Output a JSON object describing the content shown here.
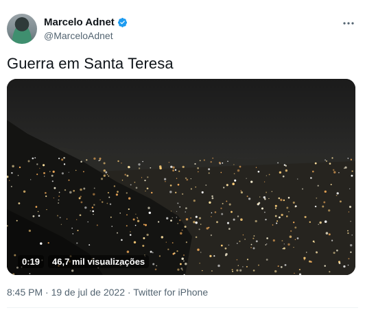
{
  "author": {
    "name": "Marcelo Adnet",
    "handle": "@MarceloAdnet",
    "verified": true,
    "verified_color": "#1d9bf0"
  },
  "icons": {
    "verified": "verified-badge-icon",
    "more": "more-options-icon"
  },
  "tweet": {
    "text": "Guerra em Santa Teresa"
  },
  "video": {
    "duration": "0:19",
    "views": "46,7 mil visualizações"
  },
  "meta": {
    "timestamp": "8:45 PM · 19 de jul de 2022 · Twitter for iPhone"
  }
}
